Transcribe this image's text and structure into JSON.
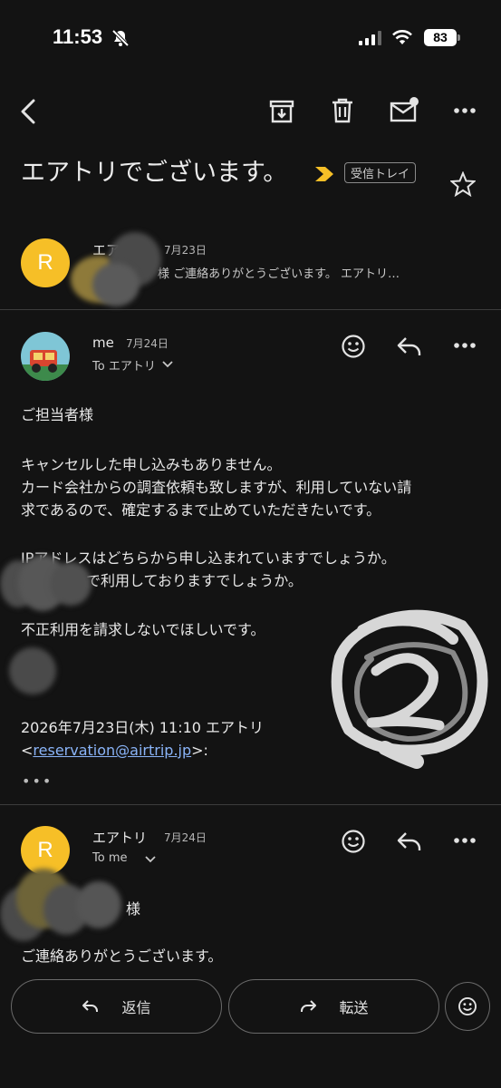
{
  "status_bar": {
    "time": "11:53",
    "battery": "83"
  },
  "subject": "エアトリでございます。",
  "label": "受信トレイ",
  "messages": [
    {
      "avatar": "R",
      "sender": "エアトリ",
      "date": "7月23日",
      "snippet": "様 ご連絡ありがとうございます。 エアトリ…"
    },
    {
      "sender": "me",
      "date": "7月24日",
      "to": "To エアトリ",
      "lines": [
        "ご担当者様",
        "キャンセルした申し込みもありません。",
        "カード会社からの調査依頼も致しますが、利用していない請",
        "求であるので、確定するまで止めていただきたいです。",
        "IPアドレスはどちらから申し込まれていますでしょうか。",
        "で利用しておりますでしょうか。",
        "不正利用を請求しないでほしいです。",
        "2026年7月23日(木) 11:10 エアトリ"
      ],
      "quote_open": "<",
      "quote_email": "reservation@airtrip.jp",
      "quote_close": ">:",
      "more": "•••"
    },
    {
      "avatar": "R",
      "sender": "エアトリ",
      "date": "7月24日",
      "to": "To me",
      "lines": [
        "様",
        "ご連絡ありがとうございます。"
      ]
    }
  ],
  "bottom_bar": {
    "reply": "返信",
    "forward": "転送"
  },
  "icons": [
    "back-arrow-icon",
    "archive-icon",
    "delete-icon",
    "mark-unread-icon",
    "more-vert-icon",
    "label-arrow-icon",
    "star-icon",
    "emoji-icon",
    "reply-icon",
    "forward-icon",
    "chevron-down-icon"
  ],
  "colors": {
    "background": "#131313",
    "avatar": "#f6bf27",
    "link": "#8ab4f8",
    "label_arrow": "#f6bf27"
  },
  "annotation": "2"
}
